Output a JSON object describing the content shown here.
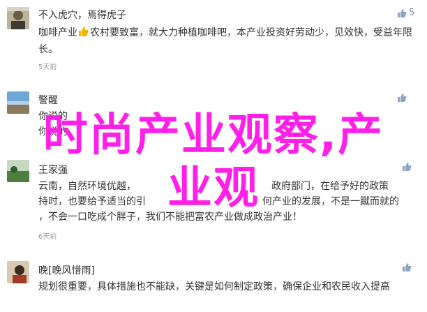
{
  "comments": [
    {
      "name": "不入虎穴，焉得虎子",
      "text_a": "咖啡产业",
      "text_b": "农村要致富，就大力种植咖啡吧，本产业投资好劳动少，见效快，受益年限长。",
      "date": "5天前",
      "likes": "5"
    },
    {
      "name": "警醒",
      "text_line1": "你说的",
      "text_line2": "你说的",
      "likes": ""
    },
    {
      "name": "王家强",
      "text_line1_a": "云南，自然环境优越，",
      "text_line1_b": "政府部门，在给予好的政策",
      "text_line2_a": "持时，也要给予适当的引",
      "text_line2_b": "何产业的发展，不是一蹴而就的",
      "text_line3": "，不会一口吃成个胖子，我们不能把富农产业做成政治产业！",
      "date": "6天前",
      "likes": ""
    },
    {
      "name": "晚[晚风惜雨]",
      "text": "规划很重要，具体措施也不能缺，关键是如何制定政策，确保企业和农民收入提高",
      "likes": ""
    }
  ],
  "overlay": {
    "line1": "时尚产业观察,产",
    "line2": "业观"
  },
  "colors": {
    "overlay": "#ff1fe8",
    "like": "#7a8fb3",
    "date": "#9a9a9a"
  }
}
